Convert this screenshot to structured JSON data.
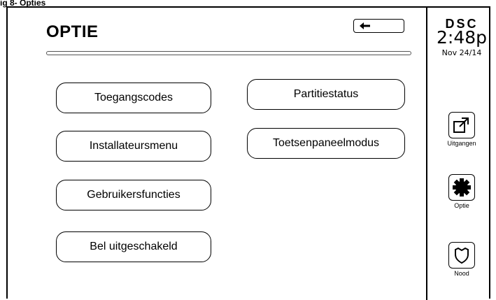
{
  "caption": "ig 8- Opties",
  "screen": {
    "title": "OPTIE",
    "left_buttons": [
      "Toegangscodes",
      "Installateursmenu",
      "Gebruikersfuncties",
      "Bel uitgeschakeld"
    ],
    "right_buttons": [
      "Partitiestatus",
      "Toetsenpaneelmodus"
    ]
  },
  "sidebar": {
    "brand": "DSC",
    "time": "2:48p",
    "date": "Nov 24/14",
    "buttons": [
      {
        "label": "Uitgangen",
        "icon": "outputs-icon"
      },
      {
        "label": "Optie",
        "icon": "gear-icon"
      },
      {
        "label": "Nood",
        "icon": "shield-icon"
      }
    ]
  }
}
